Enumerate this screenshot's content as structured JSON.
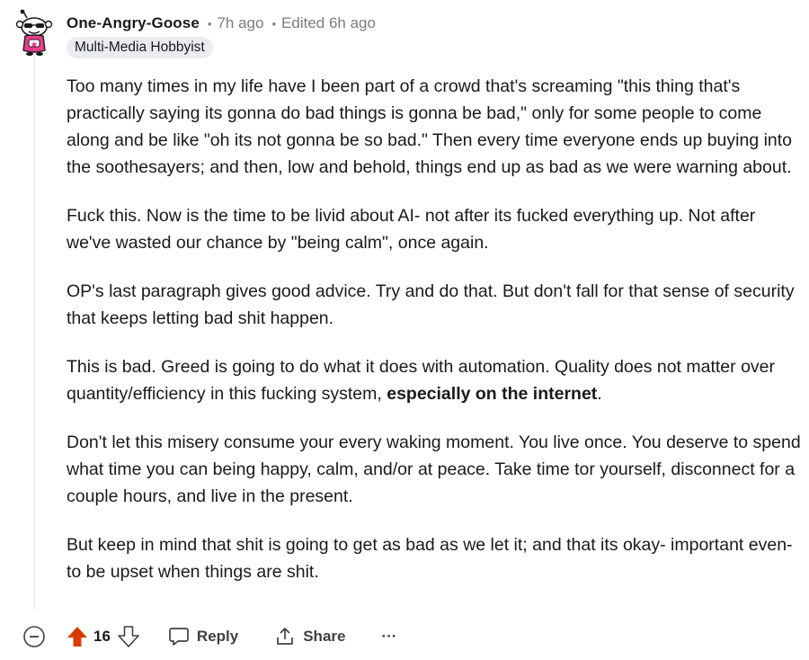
{
  "comment": {
    "username": "One-Angry-Goose",
    "posted": "7h ago",
    "edited": "Edited 6h ago",
    "flair": "Multi-Media Hobbyist",
    "paragraphs": {
      "p1": "Too many times in my life have I been part of a crowd that's screaming \"this thing that's practically saying its gonna do bad things is gonna be bad,\" only for some people to come along and be like \"oh its not gonna be so bad.\" Then every time everyone ends up buying into the soothesayers; and then, low and behold, things end up as bad as we were warning about.",
      "p2": "Fuck this. Now is the time to be livid about AI- not after its fucked everything up. Not after we've wasted our chance by \"being calm\", once again.",
      "p3": "OP's last paragraph gives good advice. Try and do that. But don't fall for that sense of security that keeps letting bad shit happen.",
      "p4_start": "This is bad. Greed is going to do what it does with automation. Quality does not matter over quantity/efficiency in this fucking system, ",
      "p4_bold": "especially on the internet",
      "p4_end": ".",
      "p5": "Don't let this misery consume your every waking moment. You live once. You deserve to spend what time you can being happy, calm, and/or at peace. Take time tor yourself, disconnect for a couple hours, and live in the present.",
      "p6": "But keep in mind that shit is going to get as bad as we let it; and that its okay- important even- to be upset when things are shit."
    }
  },
  "actions": {
    "score": "16",
    "reply_label": "Reply",
    "share_label": "Share",
    "more_label": "···"
  },
  "colors": {
    "upvote_active": "#d93a00",
    "meta_gray": "#7c7c7c",
    "flair_bg": "#eaedef"
  },
  "icons": {
    "collapse": "collapse-icon",
    "upvote": "upvote-icon",
    "downvote": "downvote-icon",
    "reply": "comment-bubble-icon",
    "share": "share-icon",
    "more": "more-icon"
  }
}
